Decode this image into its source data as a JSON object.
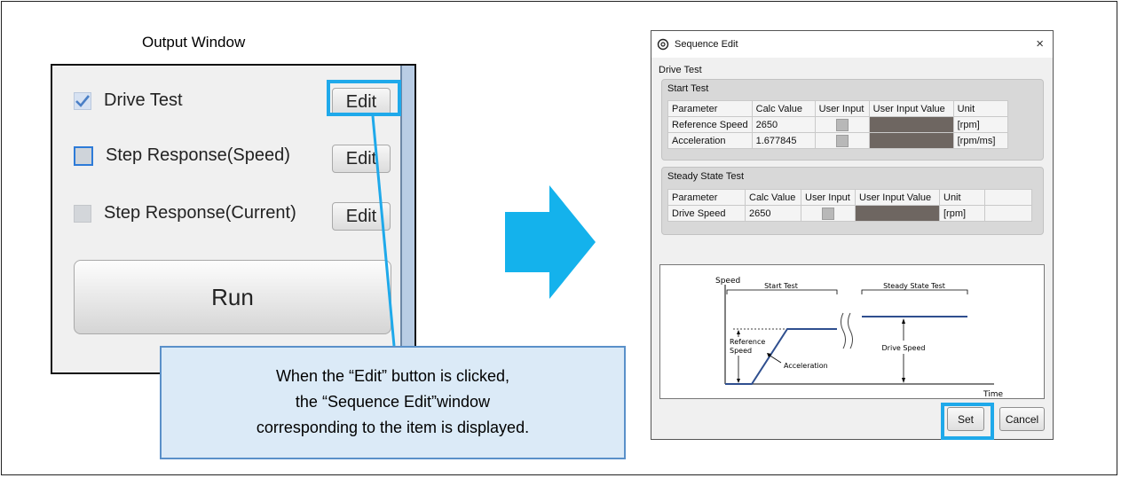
{
  "output": {
    "title": "Output Window",
    "items": [
      {
        "label": "Drive Test",
        "state": "checked",
        "edit": "Edit"
      },
      {
        "label": "Step Response(Speed)",
        "state": "focused",
        "edit": "Edit"
      },
      {
        "label": "Step Response(Current)",
        "state": "unchecked",
        "edit": "Edit"
      }
    ],
    "run_label": "Run"
  },
  "callout": {
    "line1": "When the “Edit” button is clicked,",
    "line2": "the “Sequence Edit”window",
    "line3": "corresponding to the item is displayed."
  },
  "dialog": {
    "title": "Sequence Edit",
    "close": "×",
    "section": "Drive Test",
    "start": {
      "header": "Start Test",
      "columns": [
        "Parameter",
        "Calc Value",
        "User Input",
        "User Input Value",
        "Unit"
      ],
      "rows": [
        {
          "param": "Reference Speed",
          "calc": "2650",
          "unit": "[rpm]"
        },
        {
          "param": "Acceleration",
          "calc": "1.677845",
          "unit": "[rpm/ms]"
        }
      ]
    },
    "steady": {
      "header": "Steady State Test",
      "columns": [
        "Parameter",
        "Calc Value",
        "User Input",
        "User Input Value",
        "Unit"
      ],
      "rows": [
        {
          "param": "Drive Speed",
          "calc": "2650",
          "unit": "[rpm]"
        }
      ]
    },
    "graph": {
      "y_label": "Speed",
      "x_label": "Time",
      "start_label": "Start Test",
      "steady_label": "Steady State Test",
      "ref_label_1": "Reference",
      "ref_label_2": "Speed",
      "accel_label": "Acceleration",
      "drive_label": "Drive Speed"
    },
    "set_label": "Set",
    "cancel_label": "Cancel"
  },
  "colors": {
    "highlight": "#1fa9ea",
    "arrow": "#14b2ec",
    "callout_bg": "#dbeaf7",
    "graph_line": "#2f4f8f"
  }
}
